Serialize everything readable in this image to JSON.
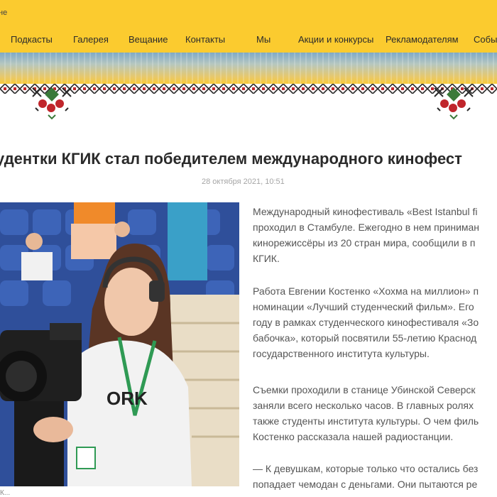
{
  "header": {
    "top_fragment": "не",
    "nav": [
      "Подкасты",
      "Галерея",
      "Вещание",
      "Контакты",
      "Мы",
      "Акции и конкурсы",
      "Рекламодателям",
      "Собы"
    ]
  },
  "article": {
    "title": "удентки КГИК стал победителем международного кинофест",
    "date": "28 октября 2021, 10:51",
    "caption": "К...",
    "paragraphs": [
      [
        "Международный кинофестиваль «Best Istanbul fi",
        "проходил в Стамбуле. Ежегодно в нем приниман",
        "кинорежиссёры из 20 стран мира, сообщили в п",
        "КГИК."
      ],
      [
        "Работа Евгении Костенко «Хохма на миллион» п",
        "номинации «Лучший студенческий фильм». Его",
        "году в рамках студенческого кинофестиваля «Зо",
        "бабочка», который посвятили 55-летию Краснод",
        "государственного института культуры."
      ],
      [
        "Съемки проходили в станице Убинской Северск",
        "заняли всего несколько часов. В главных ролях",
        "также студенты института культуры. О чем филь",
        "Костенко рассказала нашей радиостанции."
      ],
      [
        "— К девушкам, которые только что остались без",
        "попадает чемодан с деньгами. Они пытаются ре"
      ]
    ]
  },
  "colors": {
    "header_bg": "#fbcb2f",
    "ornament_red": "#c0262c",
    "ornament_green": "#3b7a3a",
    "ornament_dark": "#2a2a2a"
  },
  "icons": [
    "embroidery-ornament-icon"
  ]
}
